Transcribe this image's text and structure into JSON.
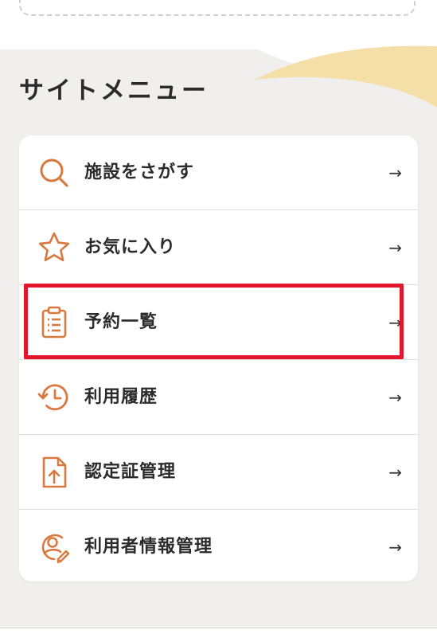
{
  "site_menu": {
    "title": "サイトメニュー",
    "items": [
      {
        "label": "施設をさがす",
        "icon": "search-icon",
        "arrow": "→"
      },
      {
        "label": "お気に入り",
        "icon": "star-icon",
        "arrow": "→"
      },
      {
        "label": "予約一覧",
        "icon": "clipboard-list-icon",
        "arrow": "→"
      },
      {
        "label": "利用履歴",
        "icon": "history-clock-icon",
        "arrow": "→"
      },
      {
        "label": "認定証管理",
        "icon": "document-upload-icon",
        "arrow": "→"
      },
      {
        "label": "利用者情報管理",
        "icon": "user-edit-icon",
        "arrow": "→"
      }
    ]
  },
  "colors": {
    "accent": "#d9783f",
    "highlight": "#e3162e",
    "wave": "#f5dfa8",
    "background": "#f0efed"
  }
}
